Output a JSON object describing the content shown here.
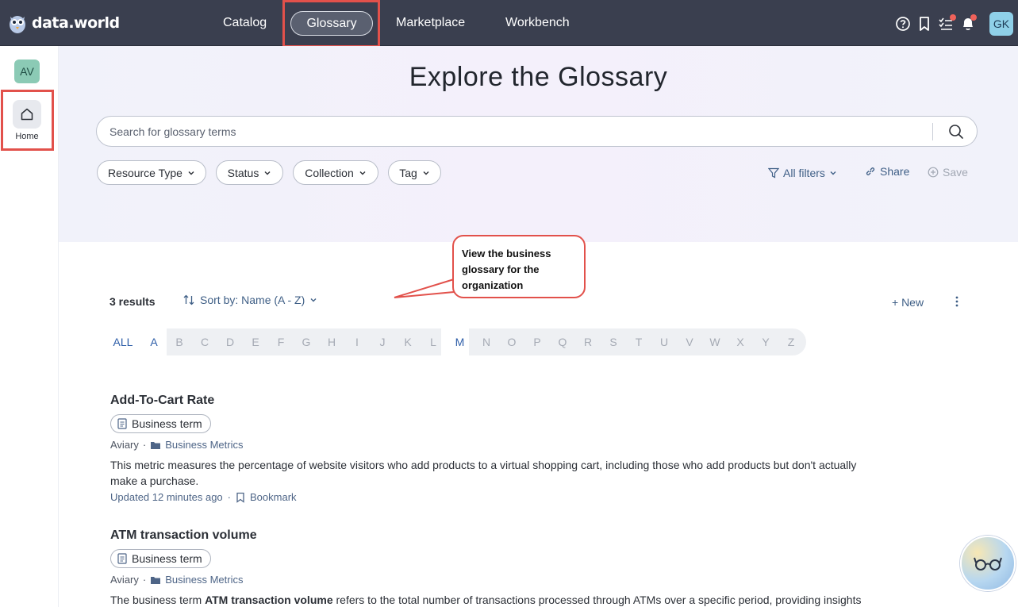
{
  "brand": {
    "name": "data.world"
  },
  "nav": {
    "items": [
      {
        "label": "Catalog"
      },
      {
        "label": "Glossary"
      },
      {
        "label": "Marketplace"
      },
      {
        "label": "Workbench"
      }
    ],
    "active": "Glossary",
    "user_initials": "GK",
    "icons": [
      "help-icon",
      "bookmark-icon",
      "tasks-icon",
      "bell-icon"
    ]
  },
  "sidebar": {
    "org_initials": "AV",
    "home_label": "Home"
  },
  "hero": {
    "title": "Explore the Glossary",
    "search_placeholder": "Search for glossary terms",
    "filters": [
      "Resource Type",
      "Status",
      "Collection",
      "Tag"
    ],
    "all_filters": "All filters",
    "share": "Share",
    "save": "Save"
  },
  "callout": {
    "text": "View the business glossary for the organization"
  },
  "results": {
    "count": "3 results",
    "sort": "Sort by: Name (A - Z)",
    "new_label": "+ New",
    "alphabet": [
      "ALL",
      "A",
      "B",
      "C",
      "D",
      "E",
      "F",
      "G",
      "H",
      "I",
      "J",
      "K",
      "L",
      "M",
      "N",
      "O",
      "P",
      "Q",
      "R",
      "S",
      "T",
      "U",
      "V",
      "W",
      "X",
      "Y",
      "Z"
    ],
    "enabled_letters": [
      "ALL",
      "A",
      "M"
    ],
    "items": [
      {
        "title": "Add-To-Cart Rate",
        "type": "Business term",
        "org": "Aviary",
        "collection": "Business Metrics",
        "description": "This metric measures the percentage of website visitors who add products to a virtual shopping cart, including those who add products but don't actually make a purchase.",
        "updated": "Updated 12 minutes ago",
        "bookmark": "Bookmark"
      },
      {
        "title": "ATM transaction volume",
        "type": "Business term",
        "org": "Aviary",
        "collection": "Business Metrics",
        "description_pre": "The business term ",
        "description_bold": "ATM transaction volume",
        "description_post": " refers to the total number of transactions processed through ATMs over a specific period, providing insights"
      }
    ]
  }
}
